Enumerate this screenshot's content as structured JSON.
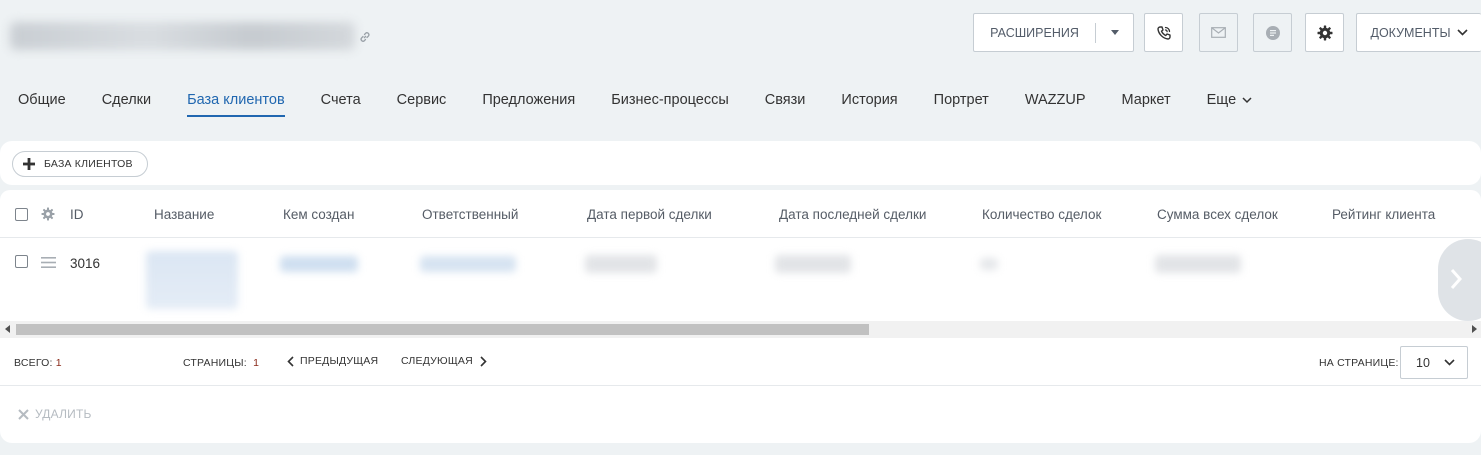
{
  "header": {
    "extensions_label": "РАСШИРЕНИЯ",
    "documents_label": "ДОКУМЕНТЫ"
  },
  "tabs": [
    {
      "label": "Общие"
    },
    {
      "label": "Сделки"
    },
    {
      "label": "База клиентов",
      "active": true
    },
    {
      "label": "Счета"
    },
    {
      "label": "Сервис"
    },
    {
      "label": "Предложения"
    },
    {
      "label": "Бизнес-процессы"
    },
    {
      "label": "Связи"
    },
    {
      "label": "История"
    },
    {
      "label": "Портрет"
    },
    {
      "label": "WAZZUP"
    },
    {
      "label": "Маркет"
    },
    {
      "label": "Еще"
    }
  ],
  "toolbar": {
    "add_label": "БАЗА КЛИЕНТОВ"
  },
  "grid": {
    "columns": [
      "ID",
      "Название",
      "Кем создан",
      "Ответственный",
      "Дата первой сделки",
      "Дата последней сделки",
      "Количество сделок",
      "Сумма всех сделок",
      "Рейтинг клиента"
    ],
    "rows": [
      {
        "id": "3016"
      }
    ]
  },
  "pager": {
    "total_label": "ВСЕГО:",
    "total_value": "1",
    "pages_label": "СТРАНИЦЫ:",
    "pages_value": "1",
    "prev_label": "ПРЕДЫДУЩАЯ",
    "next_label": "СЛЕДУЮЩАЯ",
    "per_page_label": "НА СТРАНИЦЕ:",
    "per_page_value": "10"
  },
  "footer": {
    "delete_label": "УДАЛИТЬ"
  },
  "colors": {
    "accent": "#2067b0",
    "background": "#eef2f4",
    "border": "#c6cdd3",
    "disabled_text": "#b5bbc1"
  }
}
